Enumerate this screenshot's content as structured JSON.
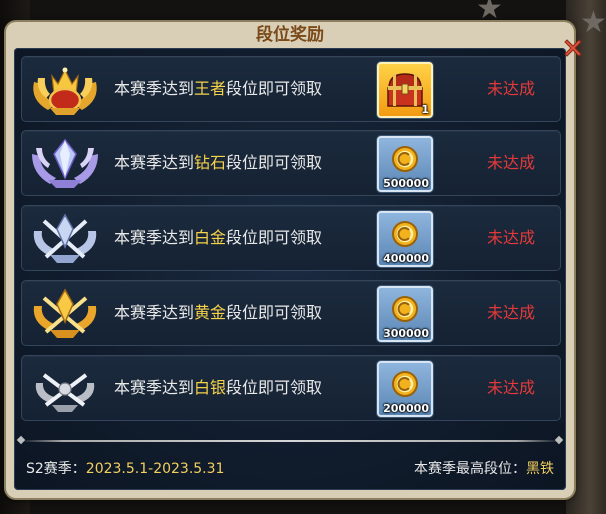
{
  "window": {
    "title": "段位奖励"
  },
  "colors": {
    "rank_highlight": "#f4d24a",
    "status_red": "#e23a3a",
    "season_gold": "#f3cf5e"
  },
  "rewards": [
    {
      "prefix": "本赛季达到",
      "rank": "王者",
      "suffix": "段位即可领取",
      "reward_icon": "treasure-chest-icon",
      "reward_qty": "1",
      "status": "未达成"
    },
    {
      "prefix": "本赛季达到",
      "rank": "钻石",
      "suffix": "段位即可领取",
      "reward_icon": "gold-coin-icon",
      "reward_qty": "500000",
      "status": "未达成"
    },
    {
      "prefix": "本赛季达到",
      "rank": "白金",
      "suffix": "段位即可领取",
      "reward_icon": "gold-coin-icon",
      "reward_qty": "400000",
      "status": "未达成"
    },
    {
      "prefix": "本赛季达到",
      "rank": "黄金",
      "suffix": "段位即可领取",
      "reward_icon": "gold-coin-icon",
      "reward_qty": "300000",
      "status": "未达成"
    },
    {
      "prefix": "本赛季达到",
      "rank": "白银",
      "suffix": "段位即可领取",
      "reward_icon": "gold-coin-icon",
      "reward_qty": "200000",
      "status": "未达成"
    }
  ],
  "footer": {
    "season_label": "S2赛季：",
    "season_dates": "2023.5.1-2023.5.31",
    "highest_label": "本赛季最高段位：",
    "highest_value": "黑铁"
  }
}
